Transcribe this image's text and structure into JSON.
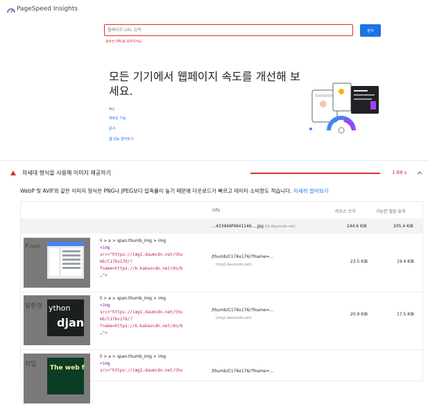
{
  "header": {
    "app_title": "PageSpeed Insights"
  },
  "search": {
    "placeholder": "웹페이지 URL 입력",
    "error": "올바른 URL을 입력하세요",
    "button": "분석"
  },
  "hero": {
    "title": "모든 기기에서 웹페이지 속도를 개선해 보세요.",
    "info_label": "확인",
    "links": [
      "새로운 기능",
      "문서",
      "웹 성능 알아보기"
    ]
  },
  "audit": {
    "title": "차세대 형식을 사용해 이미지 제공하기",
    "savings": "1.88 s",
    "description": "WebP 및 AVIF와 같은 이미지 형식은 PNG나 JPEG보다 압축률이 높기 때문에 다운로드가 빠르고 데이터 소비량도 적습니다.",
    "learn_more": "자세히 알아보기",
    "table": {
      "headers": {
        "url": "URL",
        "resource_size": "리소스 크기",
        "potential_savings": "가능한 절감 효과"
      },
      "summary": {
        "url": "…433946f4841146….jpg",
        "host": "(t1.daumcdn.net)",
        "size": "244.6 KiB",
        "savings": "205.4 KiB"
      },
      "rows": [
        {
          "thumb_text": "P.net",
          "path": "li > a > span.thumb_img > img",
          "code_tag": "<img",
          "code_src_lines": [
            "src=\"https://img1.daumcdn.net/thu",
            "mb/C176x176/?",
            "fname=https://k.kakaocdn.net/dn/b"
          ],
          "code_end": "…\">",
          "url": "/thumb/C176x176/?fname=…",
          "host": "(img1.daumcdn.net)",
          "size": "23.5 KiB",
          "savings": "19.4 KiB"
        },
        {
          "thumb_text": "발환경",
          "thumb_inner_text_top": "ython",
          "thumb_inner_text_bottom": "djan",
          "path": "li > a > span.thumb_img > img",
          "code_tag": "<img",
          "code_src_lines": [
            "src=\"https://img1.daumcdn.net/thu",
            "mb/C176x176/?",
            "fname=https://k.kakaocdn.net/dn/6"
          ],
          "code_end": "…\">",
          "url": "/thumb/C176x176/?fname=…",
          "host": "(img1.daumcdn.net)",
          "size": "20.9 KiB",
          "savings": "17.5 KiB"
        },
        {
          "thumb_text": "리업",
          "thumb_inner_text_top": "The web f",
          "path": "li > a > span.thumb_img > img",
          "code_tag": "<img",
          "code_src_lines": [
            "src=\"https://img1.daumcdn.net/thu"
          ],
          "url": "/thumb/C176x176/?fname=…"
        }
      ]
    }
  },
  "colors": {
    "accent": "#1a73e8",
    "error": "#d93025"
  }
}
